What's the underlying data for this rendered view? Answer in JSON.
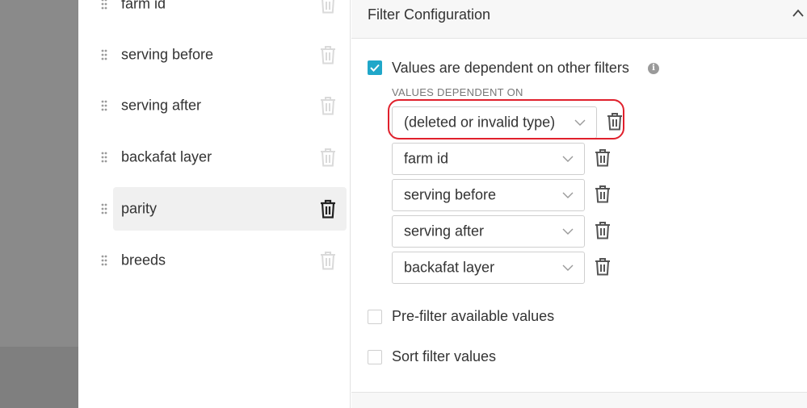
{
  "filters": {
    "items": [
      {
        "label": "farm id",
        "active": false
      },
      {
        "label": "serving before",
        "active": false
      },
      {
        "label": "serving after",
        "active": false
      },
      {
        "label": "backafat layer",
        "active": false
      },
      {
        "label": "parity",
        "active": true
      },
      {
        "label": "breeds",
        "active": false
      }
    ]
  },
  "config": {
    "title": "Filter Configuration",
    "dependent_checkbox": {
      "label": "Values are dependent on other filters",
      "checked": true
    },
    "info_glyph": "i",
    "dependent_section_label": "VALUES DEPENDENT ON",
    "dependencies": [
      {
        "value": "(deleted or invalid type)",
        "highlighted": true
      },
      {
        "value": "farm id",
        "highlighted": false
      },
      {
        "value": "serving before",
        "highlighted": false
      },
      {
        "value": "serving after",
        "highlighted": false
      },
      {
        "value": "backafat layer",
        "highlighted": false
      }
    ],
    "prefilter_checkbox": {
      "label": "Pre-filter available values",
      "checked": false
    },
    "sort_checkbox": {
      "label": "Sort filter values",
      "checked": false
    }
  },
  "colors": {
    "accent": "#20a7c9",
    "highlight": "#e0202c",
    "active_row_bg": "#f0f0f0"
  }
}
